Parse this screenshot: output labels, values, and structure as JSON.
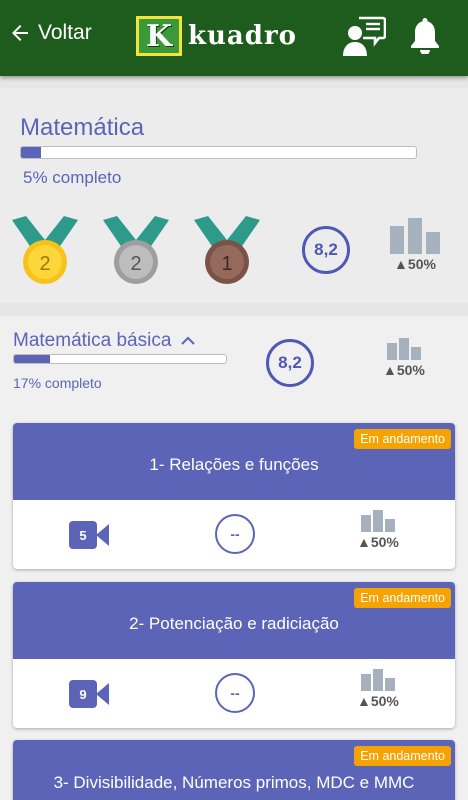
{
  "header": {
    "back_label": "Voltar",
    "logo_letter": "K",
    "logo_text": "kuadro"
  },
  "subject": {
    "title": "Matemática",
    "progress_percent": 5,
    "progress_text": "5% completo",
    "medals": [
      {
        "type": "gold",
        "count": "2"
      },
      {
        "type": "silver",
        "count": "2"
      },
      {
        "type": "bronze",
        "count": "1"
      }
    ],
    "score": "8,2",
    "rank_text": "▲50%"
  },
  "subsection": {
    "title": "Matemática básica",
    "progress_percent": 17,
    "progress_text": "17% completo",
    "score": "8,2",
    "rank_text": "▲50%"
  },
  "topics": [
    {
      "title": "1- Relações e funções",
      "status": "Em andamento",
      "video_count": "5",
      "grade": "--",
      "rank_text": "▲50%"
    },
    {
      "title": "2- Potenciação e radiciação",
      "status": "Em andamento",
      "video_count": "9",
      "grade": "--",
      "rank_text": "▲50%"
    },
    {
      "title": "3- Divisibilidade, Números primos, MDC e MMC",
      "status": "Em andamento"
    }
  ],
  "colors": {
    "header_green": "#1e5c1e",
    "accent_indigo": "#5c64b8",
    "badge_orange": "#f5a300"
  }
}
